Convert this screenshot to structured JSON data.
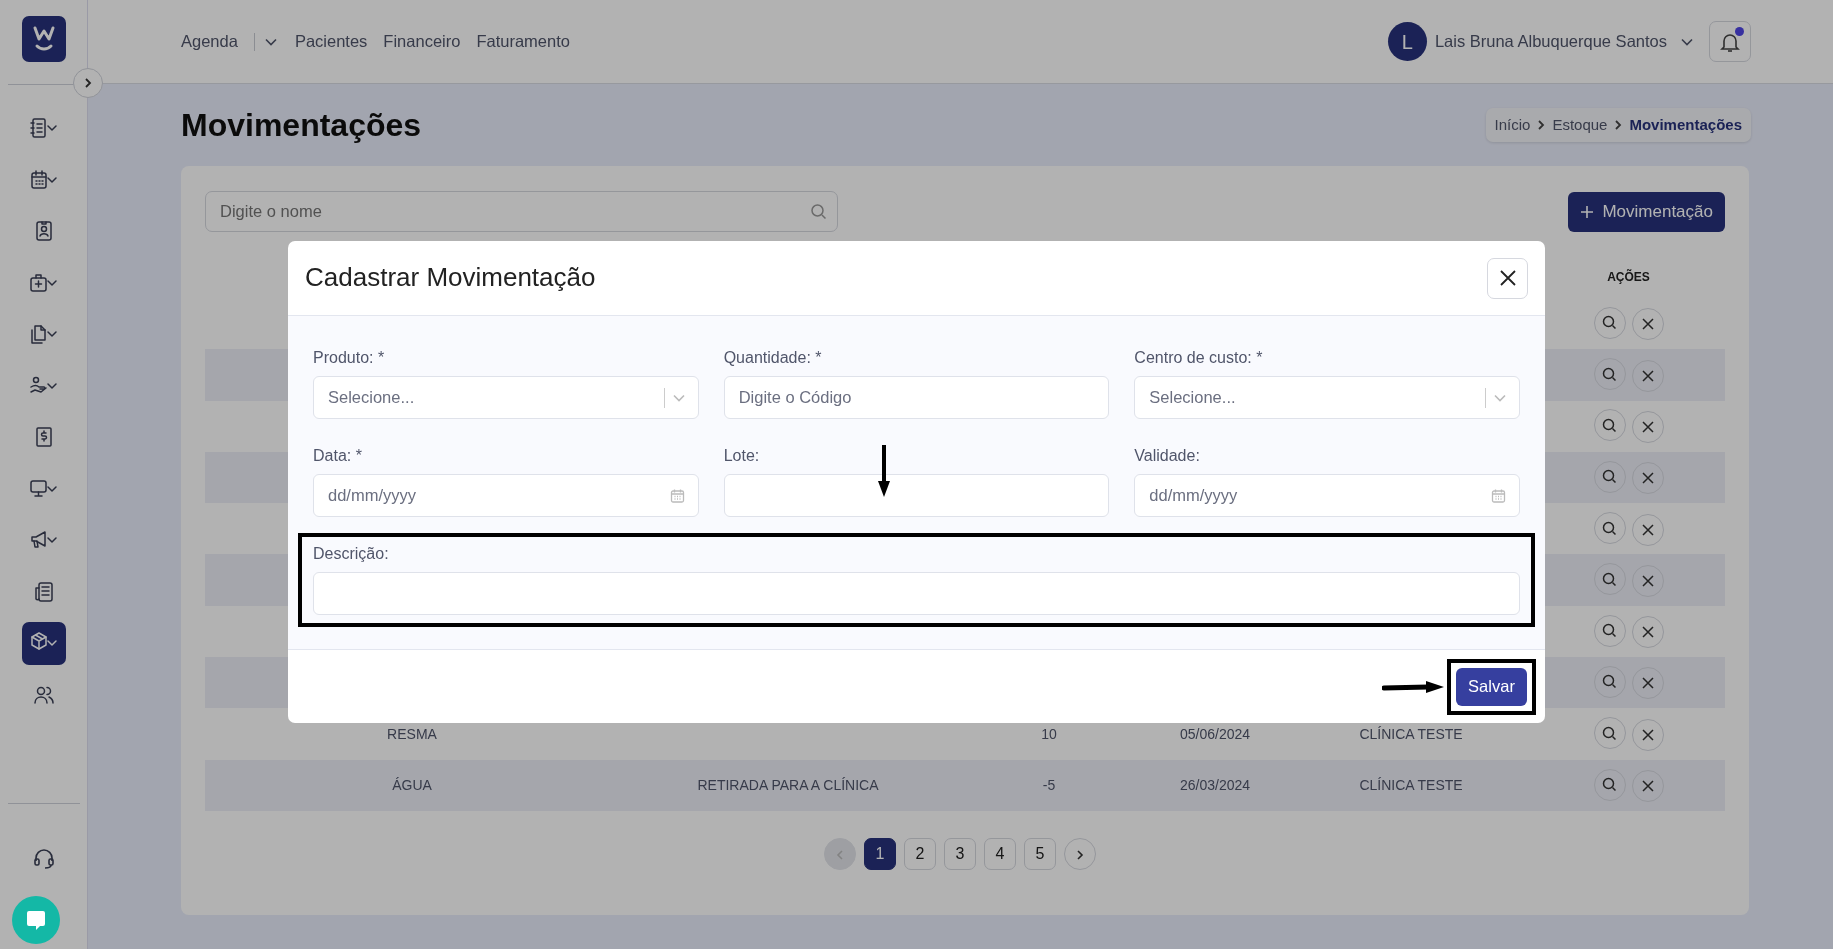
{
  "sidebar": {
    "items": [
      {
        "kind": "notebook",
        "submenu": true,
        "selected": false
      },
      {
        "kind": "calendar",
        "submenu": true,
        "selected": false
      },
      {
        "kind": "contact",
        "submenu": false,
        "selected": false
      },
      {
        "kind": "medkit",
        "submenu": true,
        "selected": false
      },
      {
        "kind": "files",
        "submenu": true,
        "selected": false
      },
      {
        "kind": "hand",
        "submenu": true,
        "selected": false
      },
      {
        "kind": "dollar",
        "submenu": false,
        "selected": false
      },
      {
        "kind": "monitor",
        "submenu": true,
        "selected": false
      },
      {
        "kind": "megaphone",
        "submenu": true,
        "selected": false
      },
      {
        "kind": "newspaper",
        "submenu": false,
        "selected": false
      },
      {
        "kind": "box",
        "submenu": true,
        "selected": true
      },
      {
        "kind": "users",
        "submenu": false,
        "selected": false
      }
    ]
  },
  "header": {
    "nav": [
      {
        "label": "Agenda",
        "dropdown": true
      },
      {
        "label": "Pacientes",
        "dropdown": false
      },
      {
        "label": "Financeiro",
        "dropdown": false
      },
      {
        "label": "Faturamento",
        "dropdown": false
      }
    ],
    "user": {
      "initial": "L",
      "name": "Lais Bruna Albuquerque Santos"
    },
    "notifications": {
      "unread": true
    }
  },
  "page": {
    "title": "Movimentações",
    "breadcrumb": [
      {
        "label": "Início",
        "current": false
      },
      {
        "label": "Estoque",
        "current": false
      },
      {
        "label": "Movimentações",
        "current": true
      }
    ]
  },
  "toolbar": {
    "search_placeholder": "Digite o nome",
    "add_button": "Movimentação"
  },
  "table": {
    "actions_header": "AÇÕES",
    "rows": [
      {
        "striped": false
      },
      {
        "striped": true
      },
      {
        "striped": false
      },
      {
        "striped": true
      },
      {
        "striped": false
      },
      {
        "striped": true
      },
      {
        "striped": false
      },
      {
        "striped": true
      },
      {
        "striped": false,
        "column_1": "RESMA",
        "column_3": "10",
        "column_4": "05/06/2024",
        "column_5": "CLÍNICA TESTE"
      },
      {
        "striped": true,
        "column_1": "ÁGUA",
        "column_2": "RETIRADA PARA A CLÍNICA",
        "column_3": "-5",
        "column_4": "26/03/2024",
        "column_5": "CLÍNICA TESTE"
      }
    ]
  },
  "pagination": {
    "prev_disabled": true,
    "pages": [
      {
        "label": "1",
        "selected": true
      },
      {
        "label": "2",
        "selected": false
      },
      {
        "label": "3",
        "selected": false
      },
      {
        "label": "4",
        "selected": false
      },
      {
        "label": "5",
        "selected": false
      }
    ]
  },
  "modal": {
    "title": "Cadastrar Movimentação",
    "fields": [
      {
        "kind": "select",
        "label": "Produto: *",
        "placeholder": "Selecione..."
      },
      {
        "kind": "text",
        "label": "Quantidade: *",
        "placeholder": "Digite o Código"
      },
      {
        "kind": "select",
        "label": "Centro de custo: *",
        "placeholder": "Selecione..."
      },
      {
        "kind": "date",
        "label": "Data: *",
        "placeholder": "dd/mm/yyyy"
      },
      {
        "kind": "text",
        "label": "Lote:",
        "pointer_arrow": true
      },
      {
        "kind": "date",
        "label": "Validade:",
        "placeholder": "dd/mm/yyyy"
      },
      {
        "kind": "wide",
        "label": "Descrição:",
        "highlighted": true
      }
    ],
    "save_button": {
      "label": "Salvar",
      "highlighted": true,
      "pointer_arrow": true
    }
  }
}
